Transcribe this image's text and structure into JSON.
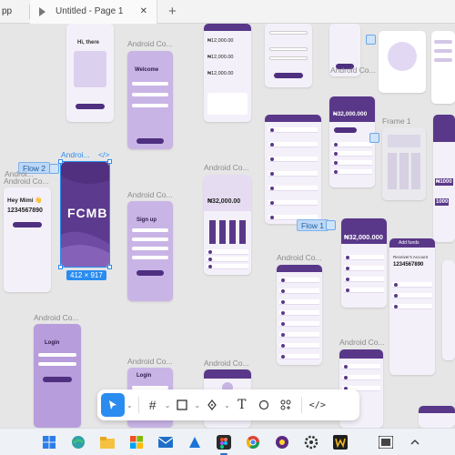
{
  "tabbar": {
    "app_label": "pp",
    "file_tab": "Untitled - Page 1",
    "close": "✕",
    "add": "+"
  },
  "canvas": {
    "frame_labels": [
      "Android Co...",
      "Android Co...",
      "Android Co...",
      "Android Co...",
      "Android Co...",
      "Android Co...",
      "Android Co...",
      "Android Co...",
      "Android Co...",
      "Android Co...",
      "Frame 1",
      "Androi..."
    ],
    "selected_frame_label": "Androi...",
    "selected_frame_size": "412 × 917",
    "flows": [
      "Flow 2",
      "Flow 1"
    ],
    "screens": {
      "hi_there_title": "Hi, there",
      "welcome_title": "Welcome",
      "fcmb_logo": "FCMB",
      "hey_mimi": "Hey Mimi 👋",
      "account_number": "1234567890",
      "signup_title": "Sign up",
      "login_title": "Login",
      "balance_small": "₦32,000.00",
      "balance_big": "₦32,000.000",
      "balance_mid": "₦32,000.000",
      "amounts": [
        "₦12,000.00",
        "₦12,000.00",
        "₦12,000.00"
      ],
      "add_funds": "Add funds",
      "receiver_acct": "Receiver's Account",
      "receiver_number": "1234567890",
      "side_numbers": [
        "₦1000",
        "1000"
      ]
    }
  },
  "toolbar": {
    "tools": [
      "move-tool",
      "frame-tool",
      "shape-tool",
      "pen-tool",
      "text-tool",
      "comment-tool",
      "actions-tool",
      "dev-mode-tool"
    ]
  },
  "taskbar": {
    "apps": [
      "windows-start",
      "search",
      "task-view",
      "edge",
      "file-explorer",
      "microsoft-store",
      "mail",
      "photos",
      "figma",
      "chrome",
      "vpn",
      "settings",
      "word",
      "other-app",
      "overflow"
    ]
  },
  "colors": {
    "brand_purple": "#5a3889",
    "selection_blue": "#2b8cf0",
    "canvas_bg": "#e6e6e6"
  }
}
